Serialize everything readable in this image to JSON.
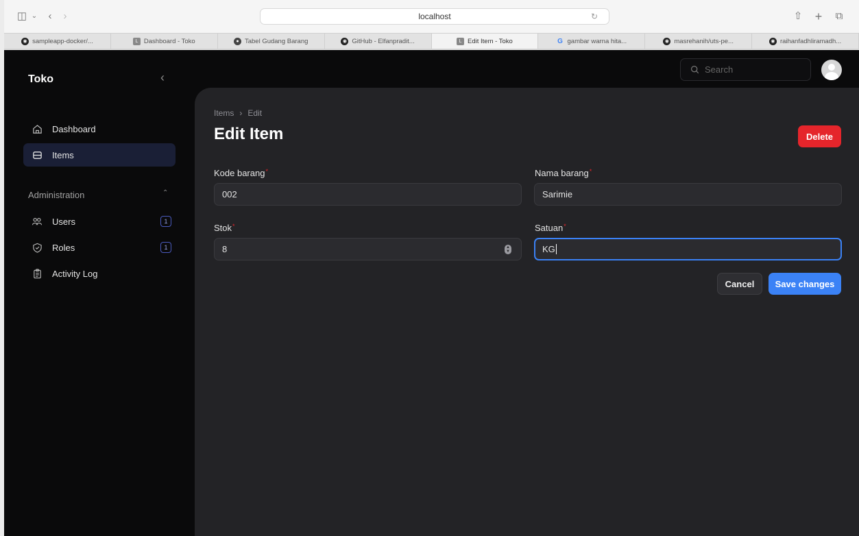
{
  "browser": {
    "url": "localhost",
    "tabs": [
      {
        "label": "sampleapp-docker/...",
        "icon": "github-icon"
      },
      {
        "label": "Dashboard - Toko",
        "icon": "app-icon"
      },
      {
        "label": "Tabel Gudang Barang",
        "icon": "site-icon"
      },
      {
        "label": "GitHub - Elfanpradit...",
        "icon": "github-icon"
      },
      {
        "label": "Edit Item - Toko",
        "icon": "app-icon"
      },
      {
        "label": "gambar warna hita...",
        "icon": "google-icon"
      },
      {
        "label": "masrehanih/uts-pe...",
        "icon": "github-icon"
      },
      {
        "label": "raihanfadhliramadh...",
        "icon": "github-icon"
      }
    ],
    "active_tab": 4
  },
  "sidebar": {
    "brand": "Toko",
    "items": [
      {
        "label": "Dashboard",
        "icon": "home-icon"
      },
      {
        "label": "Items",
        "icon": "archive-icon"
      }
    ],
    "group_label": "Administration",
    "admin_items": [
      {
        "label": "Users",
        "icon": "users-icon",
        "badge": "1"
      },
      {
        "label": "Roles",
        "icon": "shield-icon",
        "badge": "1"
      },
      {
        "label": "Activity Log",
        "icon": "clipboard-icon"
      }
    ]
  },
  "topbar": {
    "search_placeholder": "Search"
  },
  "page": {
    "breadcrumb": [
      "Items",
      "Edit"
    ],
    "title": "Edit Item",
    "delete_label": "Delete",
    "fields": {
      "kode_label": "Kode barang",
      "kode_value": "002",
      "nama_label": "Nama barang",
      "nama_value": "Sarimie",
      "stok_label": "Stok",
      "stok_value": "8",
      "satuan_label": "Satuan",
      "satuan_value": "KG"
    },
    "cancel_label": "Cancel",
    "save_label": "Save changes"
  },
  "colors": {
    "accent": "#3b82f6",
    "danger": "#e5252b",
    "sidebar_active": "#1a1f36"
  }
}
